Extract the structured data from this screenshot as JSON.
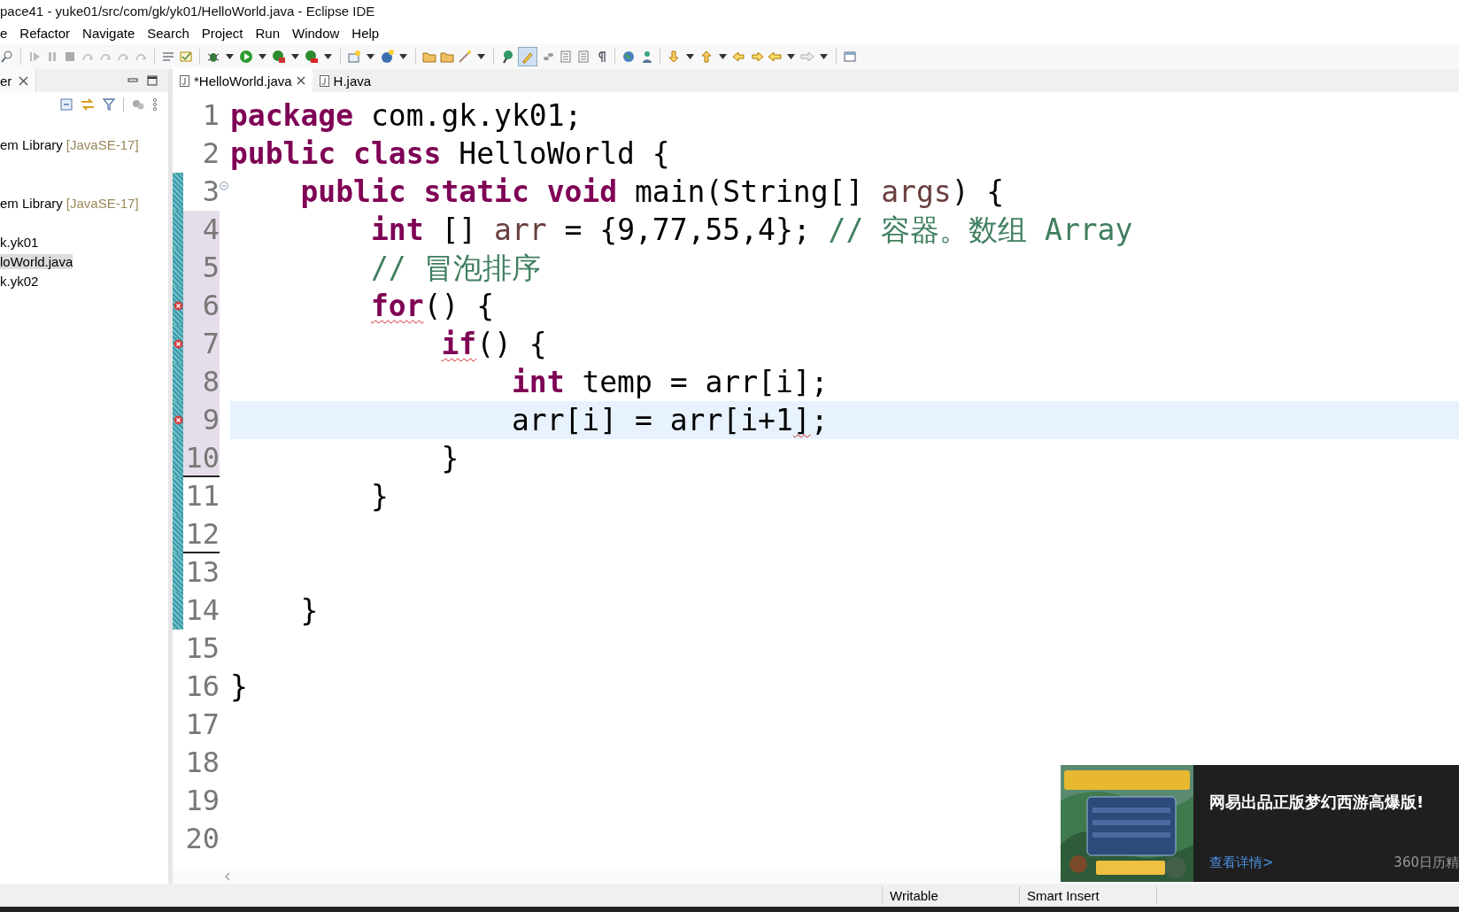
{
  "window": {
    "title": "pace41 - yuke01/src/com/gk/yk01/HelloWorld.java - Eclipse IDE"
  },
  "menu": [
    "e",
    "Refactor",
    "Navigate",
    "Search",
    "Project",
    "Run",
    "Window",
    "Help"
  ],
  "toolbar": {
    "mark_occurrences_on": true
  },
  "explorer": {
    "tab": "er",
    "items": [
      {
        "label": "em Library",
        "decoration": "[JavaSE-17]",
        "selected": false
      },
      {
        "label": "em Library",
        "decoration": "[JavaSE-17]",
        "selected": false
      },
      {
        "label": "k.yk01",
        "selected": false
      },
      {
        "label": "loWorld.java",
        "selected": true
      },
      {
        "label": "k.yk02",
        "selected": false
      }
    ]
  },
  "editor_tabs": [
    {
      "label": "*HelloWorld.java",
      "selected": true,
      "closable": true
    },
    {
      "label": "H.java",
      "selected": false,
      "closable": false
    }
  ],
  "lines": [
    {
      "number": "1",
      "error": false,
      "changed": false,
      "current": false,
      "diff": false,
      "underlined": false,
      "foldable": false,
      "segments": [
        {
          "kind": "keyword",
          "text": "package"
        },
        {
          "kind": "plain",
          "text": " com.gk.yk01;"
        }
      ]
    },
    {
      "number": "2",
      "error": false,
      "changed": false,
      "current": false,
      "diff": false,
      "underlined": false,
      "foldable": false,
      "segments": [
        {
          "kind": "keyword",
          "text": "public class"
        },
        {
          "kind": "plain",
          "text": " HelloWorld {"
        }
      ]
    },
    {
      "number": "3",
      "error": false,
      "changed": false,
      "current": false,
      "diff": true,
      "underlined": false,
      "foldable": true,
      "segments": [
        {
          "kind": "keyword",
          "text": "    public static void"
        },
        {
          "kind": "plain",
          "text": " main(String[] "
        },
        {
          "kind": "variable",
          "text": "args"
        },
        {
          "kind": "plain",
          "text": ") {"
        }
      ]
    },
    {
      "number": "4",
      "error": false,
      "changed": true,
      "current": false,
      "diff": true,
      "underlined": false,
      "foldable": false,
      "segments": [
        {
          "kind": "keyword",
          "text": "        int"
        },
        {
          "kind": "plain",
          "text": " [] "
        },
        {
          "kind": "variable",
          "text": "arr"
        },
        {
          "kind": "plain",
          "text": " = {9,77,55,4}; "
        },
        {
          "kind": "comment",
          "text": "// 容器。数组 Array"
        }
      ]
    },
    {
      "number": "5",
      "error": false,
      "changed": true,
      "current": false,
      "diff": true,
      "underlined": false,
      "foldable": false,
      "segments": [
        {
          "kind": "comment",
          "text": "        // 冒泡排序"
        }
      ]
    },
    {
      "number": "6",
      "error": true,
      "changed": true,
      "current": false,
      "diff": true,
      "underlined": false,
      "foldable": false,
      "segments": [
        {
          "kind": "keyword",
          "text": "        for",
          "squiggle": true
        },
        {
          "kind": "plain",
          "text": "() {"
        }
      ]
    },
    {
      "number": "7",
      "error": true,
      "changed": true,
      "current": false,
      "diff": true,
      "underlined": false,
      "foldable": false,
      "segments": [
        {
          "kind": "keyword",
          "text": "            if",
          "squiggle": true
        },
        {
          "kind": "plain",
          "text": "() {"
        }
      ]
    },
    {
      "number": "8",
      "error": false,
      "changed": true,
      "current": false,
      "diff": true,
      "underlined": false,
      "foldable": false,
      "segments": [
        {
          "kind": "keyword",
          "text": "                int"
        },
        {
          "kind": "plain",
          "text": " temp = arr[i];"
        }
      ]
    },
    {
      "number": "9",
      "error": true,
      "changed": true,
      "current": true,
      "diff": true,
      "underlined": false,
      "foldable": false,
      "segments": [
        {
          "kind": "plain",
          "text": "                arr[i] = arr[i+1"
        },
        {
          "kind": "plain",
          "text": "]",
          "squiggle": true
        },
        {
          "kind": "plain",
          "text": ";"
        }
      ]
    },
    {
      "number": "10",
      "error": false,
      "changed": true,
      "current": false,
      "diff": true,
      "underlined": true,
      "foldable": false,
      "segments": [
        {
          "kind": "plain",
          "text": "            }"
        }
      ]
    },
    {
      "number": "11",
      "error": false,
      "changed": false,
      "current": false,
      "diff": true,
      "underlined": false,
      "foldable": false,
      "segments": [
        {
          "kind": "plain",
          "text": "        }"
        }
      ]
    },
    {
      "number": "12",
      "error": false,
      "changed": false,
      "current": false,
      "diff": true,
      "underlined": true,
      "foldable": false
    },
    {
      "number": "13",
      "error": false,
      "changed": false,
      "current": false,
      "diff": true,
      "underlined": false,
      "foldable": false
    },
    {
      "number": "14",
      "error": false,
      "changed": false,
      "current": false,
      "diff": true,
      "underlined": false,
      "foldable": false,
      "segments": [
        {
          "kind": "plain",
          "text": "    }"
        }
      ]
    },
    {
      "number": "15",
      "error": false,
      "changed": false,
      "current": false,
      "diff": false,
      "underlined": false,
      "foldable": false
    },
    {
      "number": "16",
      "error": false,
      "changed": false,
      "current": false,
      "diff": false,
      "underlined": false,
      "foldable": false,
      "segments": [
        {
          "kind": "plain",
          "text": "}"
        }
      ]
    },
    {
      "number": "17",
      "error": false,
      "changed": false,
      "current": false,
      "diff": false,
      "underlined": false,
      "foldable": false
    },
    {
      "number": "18",
      "error": false,
      "changed": false,
      "current": false,
      "diff": false,
      "underlined": false,
      "foldable": false
    },
    {
      "number": "19",
      "error": false,
      "changed": false,
      "current": false,
      "diff": false,
      "underlined": false,
      "foldable": false
    },
    {
      "number": "20",
      "error": false,
      "changed": false,
      "current": false,
      "diff": false,
      "underlined": false,
      "foldable": false
    }
  ],
  "status_bar": [
    "Writable",
    "Smart Insert"
  ],
  "notification": {
    "title": "网易出品正版梦幻西游高爆版!",
    "link": "查看详情>",
    "source": "360日历精"
  }
}
